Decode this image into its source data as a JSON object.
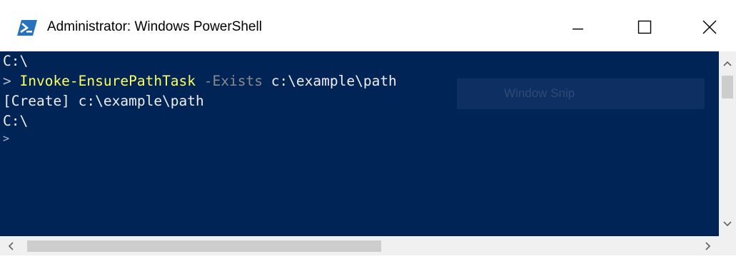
{
  "window": {
    "title": "Administrator: Windows PowerShell",
    "app_icon": "powershell-icon",
    "controls": [
      "minimize-icon",
      "maximize-icon",
      "close-icon"
    ]
  },
  "console": {
    "lines": [
      {
        "prompt_path": "C:\\"
      },
      {
        "prompt": "> ",
        "command": "Invoke-EnsurePathTask",
        "param": " -Exists",
        "arg": " c:\\example\\path"
      },
      {
        "output": "[Create] c:\\example\\path"
      },
      {
        "prompt_path": "C:\\"
      },
      {
        "prompt": ">"
      }
    ],
    "overlay_label": "Window Snip"
  },
  "colors": {
    "console_bg": "#012456",
    "command": "#ffff5f",
    "parameter": "#8a8a8a",
    "text": "#eeedf0",
    "scrollbar_bg": "#f0f0f0",
    "scrollbar_thumb": "#cdcdcd"
  },
  "scrollbars": {
    "vertical_icons": [
      "chevron-up-icon",
      "chevron-down-icon"
    ],
    "horizontal_icons": [
      "chevron-left-icon",
      "chevron-right-icon"
    ]
  }
}
